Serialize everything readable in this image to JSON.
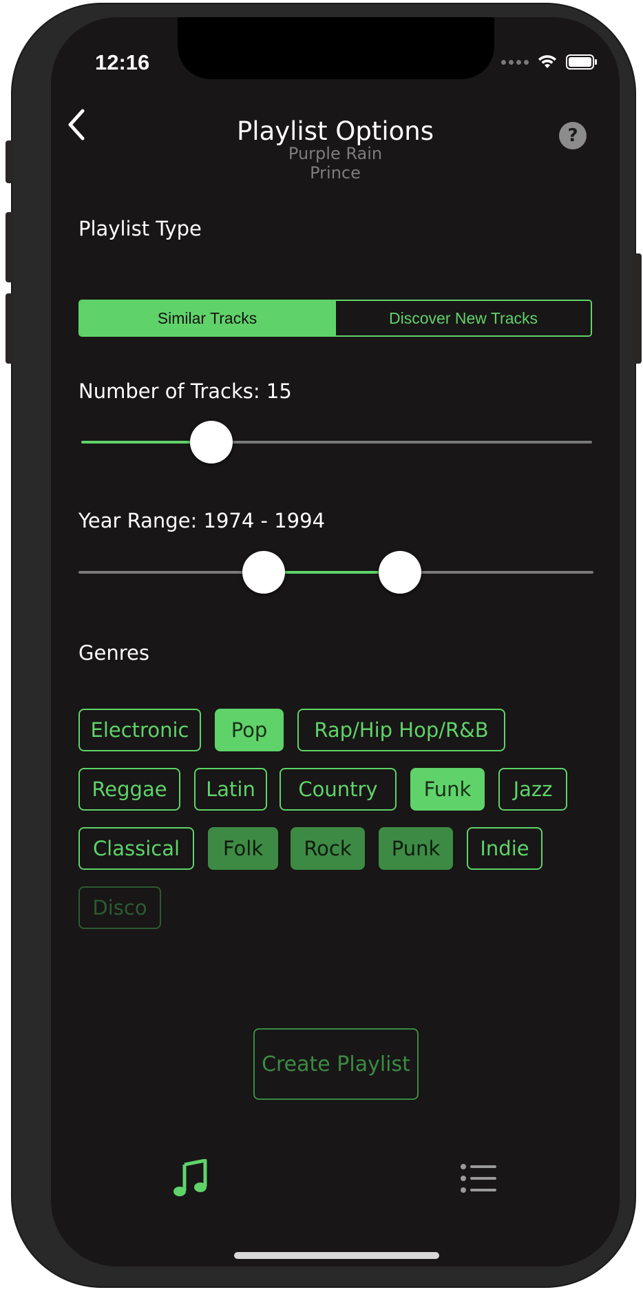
{
  "status_bar": {
    "time": "12:16"
  },
  "nav": {
    "title": "Playlist Options",
    "back_icon": "chevron-left-icon",
    "help_label": "?"
  },
  "track": {
    "title": "Purple Rain",
    "artist": "Prince"
  },
  "playlist_type": {
    "label": "Playlist Type",
    "options": [
      "Similar Tracks",
      "Discover New Tracks"
    ],
    "selected": "Similar Tracks"
  },
  "tracks_slider": {
    "label": "Number of Tracks: 15",
    "value": 15
  },
  "year_slider": {
    "label": "Year Range: 1974 - 1994",
    "min_value": 1974,
    "max_value": 1994
  },
  "genres": {
    "label": "Genres",
    "items": [
      {
        "name": "Electronic",
        "state": "unselected"
      },
      {
        "name": "Pop",
        "state": "selected"
      },
      {
        "name": "Rap/Hip Hop/R&B",
        "state": "unselected"
      },
      {
        "name": "Reggae",
        "state": "unselected"
      },
      {
        "name": "Latin",
        "state": "unselected"
      },
      {
        "name": "Country",
        "state": "unselected"
      },
      {
        "name": "Funk",
        "state": "selected"
      },
      {
        "name": "Jazz",
        "state": "unselected"
      },
      {
        "name": "Classical",
        "state": "unselected"
      },
      {
        "name": "Folk",
        "state": "selected"
      },
      {
        "name": "Rock",
        "state": "selected"
      },
      {
        "name": "Punk",
        "state": "selected"
      },
      {
        "name": "Indie",
        "state": "unselected"
      },
      {
        "name": "Disco",
        "state": "unselected"
      }
    ]
  },
  "create_button": {
    "label": "Create Playlist"
  },
  "tab_bar": {
    "tabs": [
      "music-note-icon",
      "list-icon"
    ],
    "active": "music-note-icon"
  },
  "colors": {
    "accent": "#5fd36a",
    "background": "#181616",
    "muted_accent": "#3c8a44"
  }
}
